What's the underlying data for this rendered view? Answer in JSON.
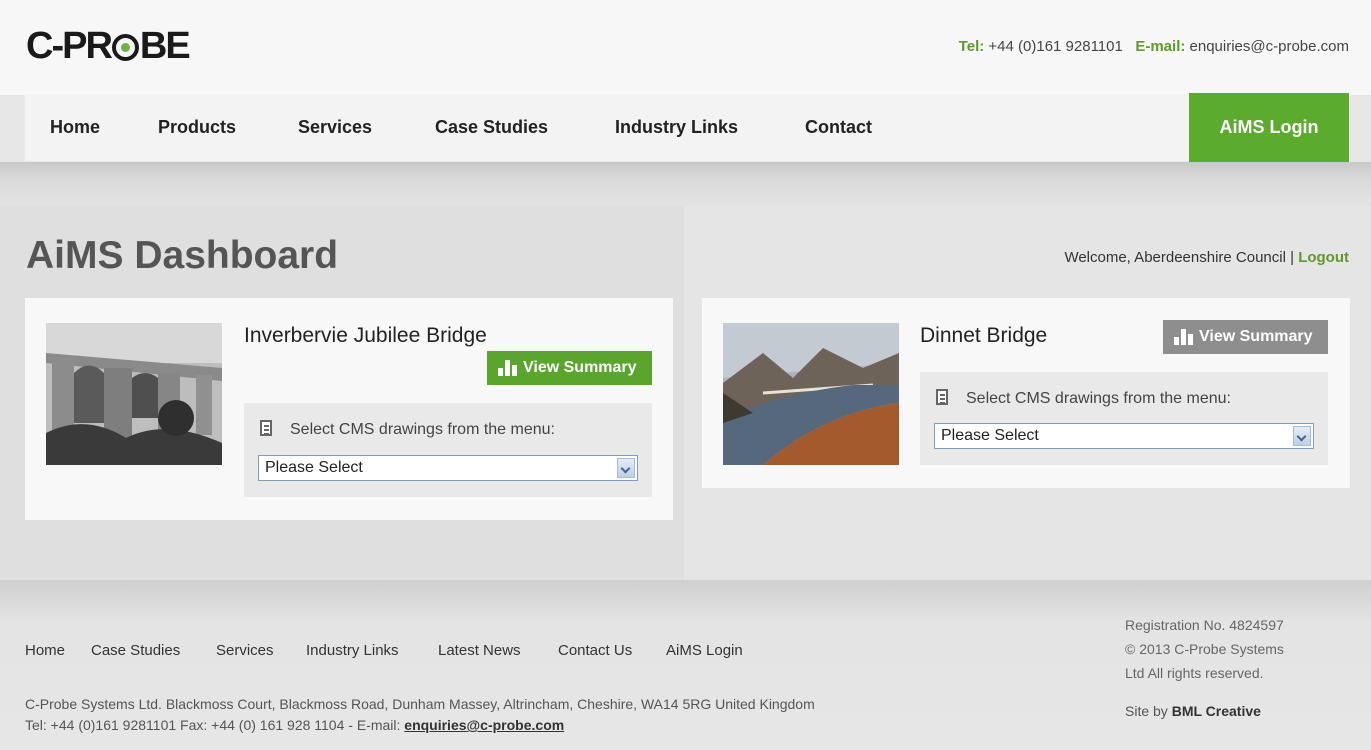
{
  "header": {
    "logo": {
      "pre": "C-PR",
      "post": "BE"
    },
    "tel_label": "Tel:",
    "tel_value": "+44 (0)161 9281101",
    "email_label": "E-mail:",
    "email_value": "enquiries@c-probe.com"
  },
  "nav": {
    "items": [
      "Home",
      "Products",
      "Services",
      "Case Studies",
      "Industry Links",
      "Contact"
    ],
    "aims_login": "AiMS Login"
  },
  "dashboard": {
    "title": "AiMS Dashboard",
    "welcome": "Welcome, Aberdeenshire Council |",
    "logout": "Logout"
  },
  "bridges": [
    {
      "name": "Inverbervie Jubilee Bridge",
      "summary_label": "View Summary",
      "select_label": "Select CMS drawings from the menu:",
      "select_value": "Please Select",
      "button_color": "#5aa62d"
    },
    {
      "name": "Dinnet Bridge",
      "summary_label": "View Summary",
      "select_label": "Select CMS drawings from the menu:",
      "select_value": "Please Select",
      "button_color": "#8e8e8e"
    }
  ],
  "footer": {
    "links": [
      "Home",
      "Case Studies",
      "Services",
      "Industry Links",
      "Latest News",
      "Contact Us",
      "AiMS Login"
    ],
    "address": "C-Probe Systems Ltd. Blackmoss Court, Blackmoss Road, Dunham Massey, Altrincham, Cheshire, WA14 5RG United Kingdom",
    "tel_line": "Tel: +44 (0)161 9281101 Fax: +44 (0) 161 928 1104 - E-mail:",
    "email": "enquiries@c-probe.com",
    "registration": [
      "Registration No. 4824597",
      "© 2013 C-Probe Systems",
      "Ltd All rights reserved."
    ],
    "site_by_label": "Site by",
    "site_by_name": "BML Creative"
  },
  "colors": {
    "accent_green": "#5aa62d",
    "grey_button": "#8e8e8e"
  }
}
